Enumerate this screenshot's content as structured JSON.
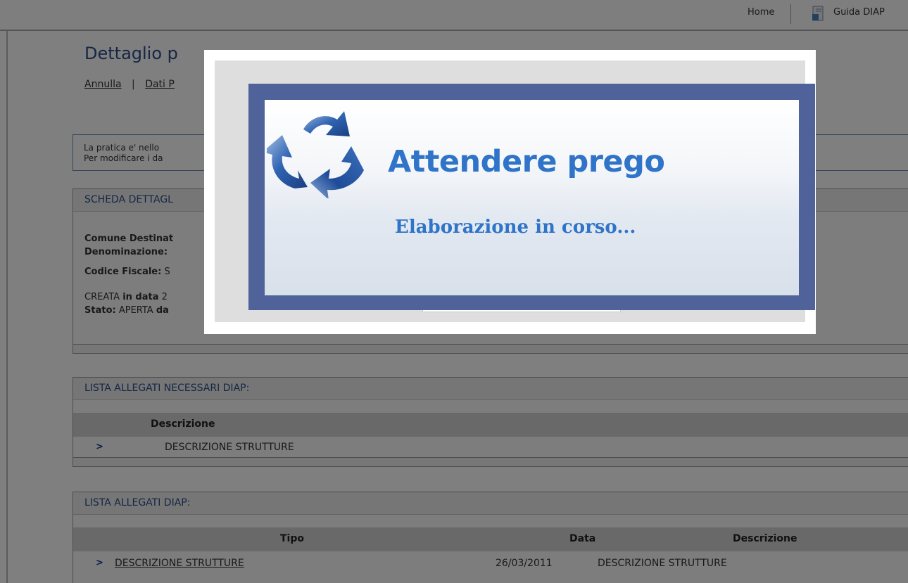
{
  "topbar": {
    "home_label": "Home",
    "guida_label": "Guida DIAP"
  },
  "header": {
    "title": "Dettaglio p",
    "nav": {
      "annulla": "Annulla",
      "separator": "|",
      "dati": "Dati P"
    }
  },
  "info": {
    "line1": "La pratica e' nello",
    "line2": "Per modificare i da"
  },
  "scheda": {
    "header": "SCHEDA DETTAGL",
    "comune_label": "Comune Destinat",
    "denominazione_label": "Denominazione:",
    "codice_label": "Codice Fiscale:",
    "codice_value": "S",
    "creata_value": "CREATA",
    "in_data_label": "in data",
    "in_data_value": "2",
    "stato_label": "Stato:",
    "stato_value": "APERTA",
    "da_label": "da"
  },
  "allegati_necessari": {
    "header": "LISTA ALLEGATI NECESSARI DIAP:",
    "columns": [
      "Descrizione"
    ],
    "rows": [
      {
        "descrizione": "DESCRIZIONE STRUTTURE"
      }
    ]
  },
  "allegati_diap": {
    "header": "LISTA ALLEGATI DIAP:",
    "columns": [
      "Tipo",
      "Data",
      "Descrizione"
    ],
    "rows": [
      {
        "tipo": "DESCRIZIONE STRUTTURE",
        "data": "26/03/2011",
        "descrizione": "DESCRIZIONE STRUTTURE"
      }
    ]
  },
  "modal": {
    "title": "Attendere prego",
    "subtitle": "Elaborazione in corso..."
  },
  "colors": {
    "overlay": "rgba(0,0,0,0.5)",
    "link_blue": "#2a4e8a",
    "modal_text": "#2f74c8",
    "modal_frame": "#4f629a",
    "bullet": "#1d3a8a"
  },
  "icons": {
    "guida": "document-icon",
    "modal": "recycle-icon",
    "row_bullet": "chevron-right-icon"
  }
}
